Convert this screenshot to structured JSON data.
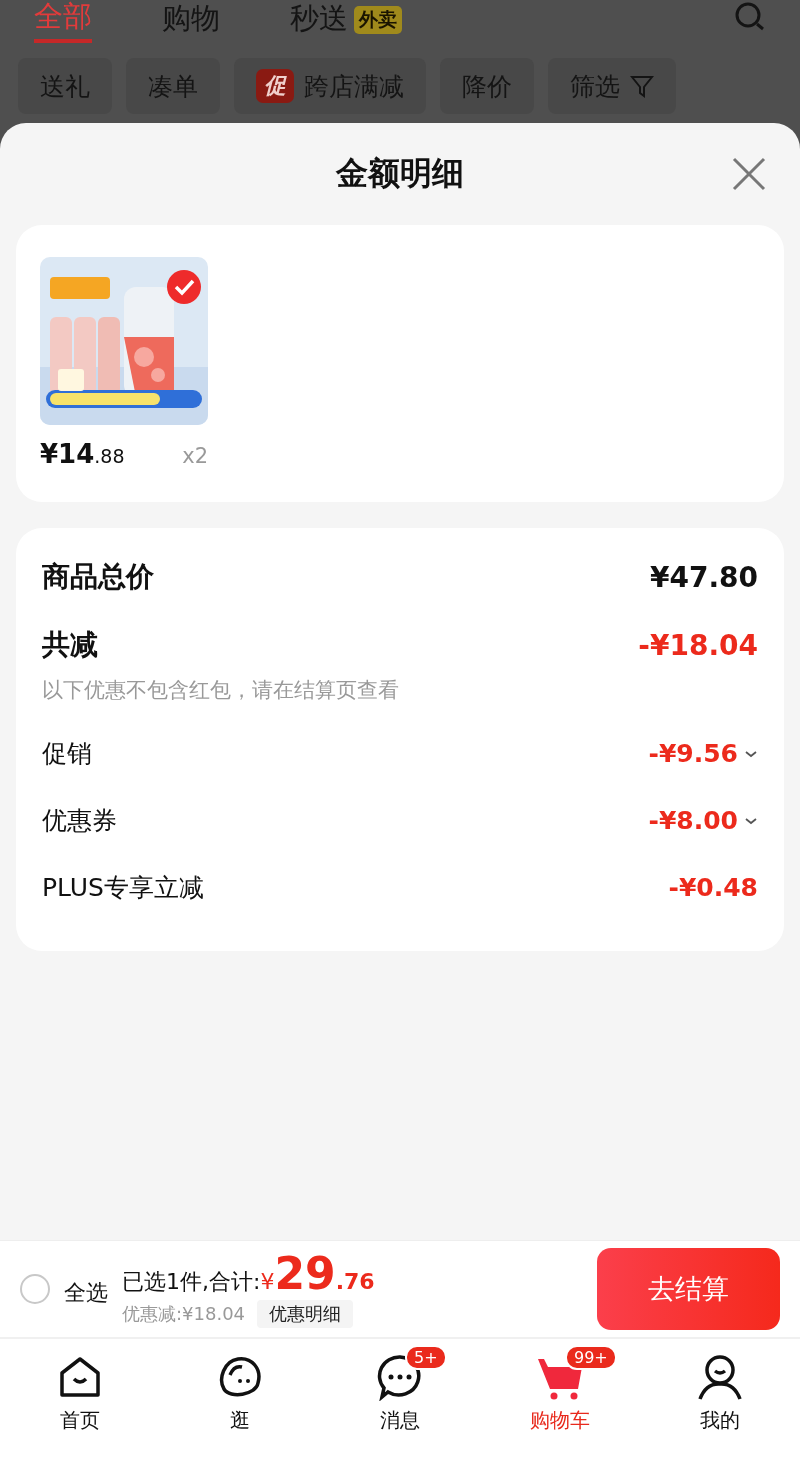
{
  "top_tabs": [
    {
      "label": "全部",
      "selected": true
    },
    {
      "label": "购物",
      "selected": false
    },
    {
      "label": "秒送",
      "selected": false,
      "badge": "外卖"
    }
  ],
  "filter_chips": [
    {
      "label": "送礼",
      "kind": "plain"
    },
    {
      "label": "凑单",
      "kind": "plain"
    },
    {
      "label": "跨店满减",
      "kind": "promo",
      "tag": "促"
    },
    {
      "label": "降价",
      "kind": "plain"
    },
    {
      "label": "筛选",
      "kind": "filter"
    }
  ],
  "sheet": {
    "title": "金额明细",
    "product": {
      "kind": "picture",
      "selected": true,
      "price_symbol": "¥",
      "price_main": "14",
      "price_decimal": ".88",
      "quantity": "x2"
    },
    "summary": {
      "total_label": "商品总价",
      "total_value": "¥47.80",
      "discount_label": "共减",
      "discount_value": "-¥18.04",
      "discount_note": "以下优惠不包含红包，请在结算页查看",
      "items": [
        {
          "label": "促销",
          "value": "-¥9.56",
          "expandable": true
        },
        {
          "label": "优惠券",
          "value": "-¥8.00",
          "expandable": true
        },
        {
          "label": "PLUS专享立减",
          "value": "-¥0.48",
          "expandable": false
        }
      ]
    }
  },
  "bottom_bar": {
    "select_all_checked": false,
    "select_all_label": "全选",
    "selected_text": "已选1件,合计:",
    "currency": "¥",
    "total_main": "29",
    "total_decimal": ".76",
    "saved_text": "优惠减:¥18.04",
    "detail_button": "优惠明细",
    "checkout_button": "去结算"
  },
  "tab_bar": [
    {
      "kind": "home",
      "label": "首页",
      "selected": false
    },
    {
      "kind": "explore",
      "label": "逛",
      "selected": false
    },
    {
      "kind": "messages",
      "label": "消息",
      "selected": false,
      "badge": "5+"
    },
    {
      "kind": "cart",
      "label": "购物车",
      "selected": true,
      "badge": "99+"
    },
    {
      "kind": "profile",
      "label": "我的",
      "selected": false
    }
  ]
}
